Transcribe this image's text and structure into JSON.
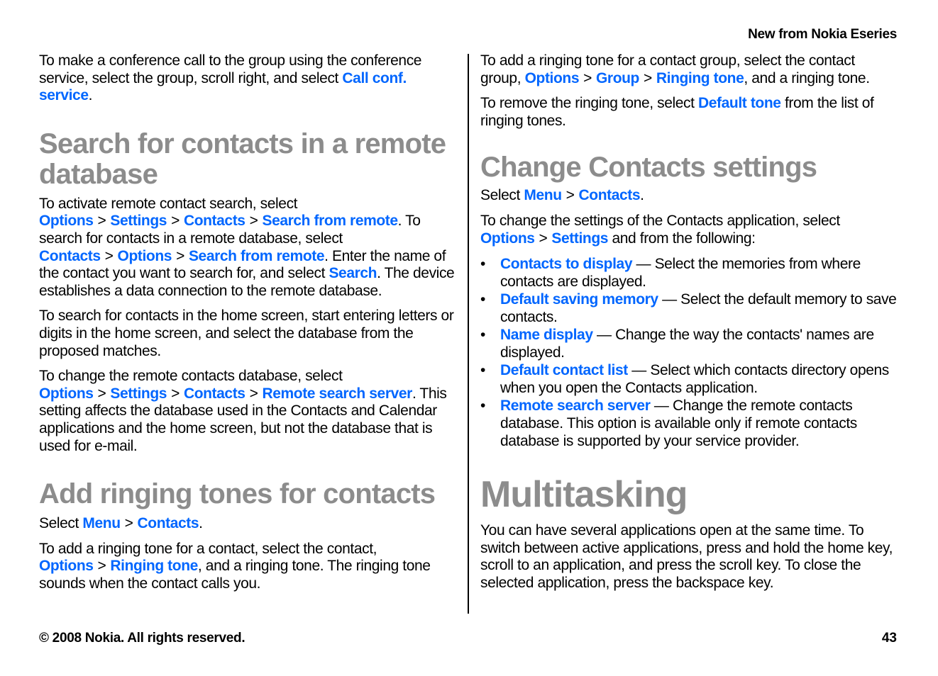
{
  "header": {
    "section_title": "New from Nokia Eseries"
  },
  "left": {
    "intro": {
      "t1": "To make a conference call to the group using the conference service, select the group, scroll right, and select ",
      "l1": "Call conf. service",
      "t2": "."
    },
    "search_section": {
      "heading": "Search for contacts in a remote database",
      "p1": {
        "t1": "To activate remote contact search, select ",
        "l1": "Options",
        "l2": "Settings",
        "l3": "Contacts",
        "l4": "Search from remote",
        "t2": ". To search for contacts in a remote database, select ",
        "l5": "Contacts",
        "l6": "Options",
        "l7": "Search from remote",
        "t3": ". Enter the name of the contact you want to search for, and select ",
        "l8": "Search",
        "t4": ". The device establishes a data connection to the remote database."
      },
      "p2": "To search for contacts in the home screen, start entering letters or digits in the home screen, and select the database from the proposed matches.",
      "p3": {
        "t1": "To change the remote contacts database, select ",
        "l1": "Options",
        "l2": "Settings",
        "l3": "Contacts",
        "l4": "Remote search server",
        "t2": ". This setting affects the database used in the Contacts and Calendar applications and the home screen, but not the database that is used for e-mail."
      }
    },
    "ringing_section": {
      "heading": "Add ringing tones for contacts",
      "p1": {
        "t1": "Select ",
        "l1": "Menu",
        "l2": "Contacts",
        "t2": "."
      },
      "p2": {
        "t1": "To add a ringing tone for a contact, select the contact, ",
        "l1": "Options",
        "l2": "Ringing tone",
        "t2": ", and a ringing tone. The ringing tone sounds when the contact calls you."
      }
    }
  },
  "right": {
    "p1": {
      "t1": "To add a ringing tone for a contact group, select the contact group, ",
      "l1": "Options",
      "l2": "Group",
      "l3": "Ringing tone",
      "t2": ", and a ringing tone."
    },
    "p2": {
      "t1": "To remove the ringing tone, select ",
      "l1": "Default tone",
      "t2": " from the list of ringing tones."
    },
    "settings_section": {
      "heading": "Change Contacts settings",
      "p1": {
        "t1": "Select ",
        "l1": "Menu",
        "l2": "Contacts",
        "t2": "."
      },
      "p2": {
        "t1": "To change the settings of the Contacts application, select ",
        "l1": "Options",
        "l2": "Settings",
        "t2": " and from the following:"
      },
      "items": [
        {
          "label": "Contacts to display",
          "desc": " — Select the memories from where contacts are displayed."
        },
        {
          "label": "Default saving memory",
          "desc": " — Select the default memory to save contacts."
        },
        {
          "label": "Name display",
          "desc": " — Change the way the contacts' names are displayed."
        },
        {
          "label": "Default contact list",
          "desc": " — Select which contacts directory opens when you open the Contacts application."
        },
        {
          "label": "Remote search server",
          "desc": " — Change the remote contacts database. This option is available only if remote contacts database is supported by your service provider."
        }
      ]
    },
    "multitasking": {
      "heading": "Multitasking",
      "p1": "You can have several applications open at the same time. To switch between active applications, press and hold the home key, scroll to an application, and press the scroll key. To close the selected application, press the backspace key."
    }
  },
  "symbols": {
    "sep": ">",
    "bullet": "•"
  },
  "footer": {
    "copyright": "© 2008 Nokia. All rights reserved.",
    "page_number": "43"
  },
  "colors": {
    "link": "#0066ff",
    "heading": "#8c8c8c",
    "text": "#000000"
  }
}
